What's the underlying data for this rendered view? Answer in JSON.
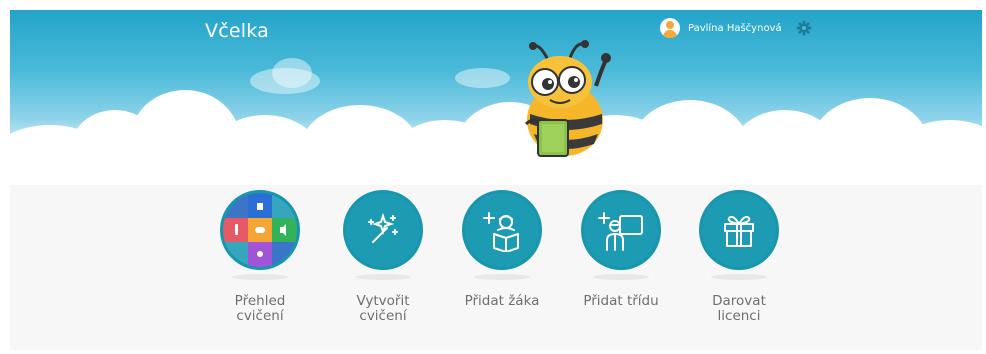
{
  "app": {
    "title": "Včelka"
  },
  "header": {
    "user_name": "Pavlína Haščynová",
    "icons": [
      "user-avatar-icon",
      "gear-icon"
    ]
  },
  "actions": [
    {
      "id": "overview",
      "label_line1": "Přehled",
      "label_line2": "cvičení",
      "icon": "exercise-overview-icon"
    },
    {
      "id": "create",
      "label_line1": "Vytvořit",
      "label_line2": "cvičení",
      "icon": "magic-wand-icon"
    },
    {
      "id": "add-student",
      "label_line1": "Přidat žáka",
      "label_line2": "",
      "icon": "add-student-icon"
    },
    {
      "id": "add-class",
      "label_line1": "Přidat třídu",
      "label_line2": "",
      "icon": "add-class-icon"
    },
    {
      "id": "gift",
      "label_line1": "Darovat",
      "label_line2": "licenci",
      "icon": "gift-icon"
    }
  ],
  "colors": {
    "accent": "#1d9bb2",
    "sky_top": "#23a4c9",
    "tile_blue": "#2b6fd6",
    "tile_green": "#32b35a",
    "tile_red": "#e55a66",
    "tile_orange": "#f3a634",
    "tile_purple": "#a155d6"
  }
}
